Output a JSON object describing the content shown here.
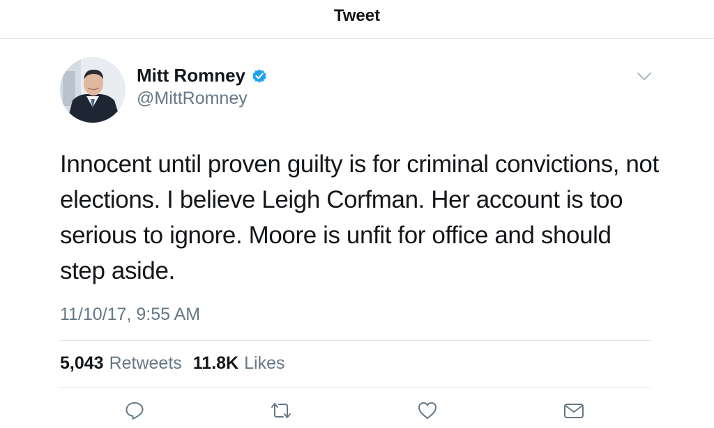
{
  "header": {
    "title": "Tweet"
  },
  "tweet": {
    "author": {
      "display_name": "Mitt Romney",
      "handle": "@MittRomney",
      "verified": true
    },
    "text": "Innocent until proven guilty is for criminal convictions, not elections. I believe Leigh Corfman. Her account is too serious to ignore. Moore is unfit for office and should step aside.",
    "timestamp": "11/10/17, 9:55 AM",
    "stats": {
      "retweets_count": "5,043",
      "retweets_label": "Retweets",
      "likes_count": "11.8K",
      "likes_label": "Likes"
    }
  },
  "actions": [
    {
      "icon": "reply-icon"
    },
    {
      "icon": "retweet-icon"
    },
    {
      "icon": "like-icon"
    },
    {
      "icon": "direct-message-icon"
    }
  ],
  "colors": {
    "text_primary": "#14171a",
    "text_secondary": "#657786",
    "verified_blue": "#1da1f2",
    "divider": "#e1e8ed"
  }
}
